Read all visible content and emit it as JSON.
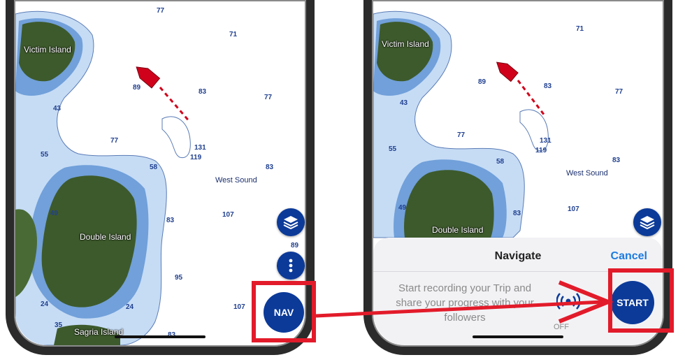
{
  "colors": {
    "water": "#c6dcf5",
    "deep_water": "#ffffff",
    "island": "#3d5a2c",
    "accent_blue": "#0b3a99",
    "highlight_red": "#e21b2a",
    "cancel_blue": "#1c7be0"
  },
  "left_screen": {
    "places": {
      "victim_island": "Victim Island",
      "double_island": "Double Island",
      "west_sound": "West Sound",
      "third_island": "Sagria Island"
    },
    "depths": {
      "d77a": "77",
      "d71": "71",
      "d89": "89",
      "d83a": "83",
      "d77b": "77",
      "d43": "43",
      "d77c": "77",
      "d55": "55",
      "d131": "131",
      "d119": "119",
      "d58": "58",
      "d83b": "83",
      "d49": "49",
      "d83c": "83",
      "d107a": "107",
      "d89b": "89",
      "d95": "95",
      "d24a": "24",
      "d24b": "24",
      "d35": "35",
      "d107b": "107",
      "d83d": "83"
    },
    "nav_label": "NAV",
    "icons": {
      "layers": "layers-icon",
      "more": "more-vertical-icon",
      "boat": "boat-icon"
    }
  },
  "right_screen": {
    "places": {
      "victim_island": "Victim Island",
      "double_island": "Double Island",
      "west_sound": "West Sound"
    },
    "depths": {
      "d71": "71",
      "d89": "89",
      "d83a": "83",
      "d77a": "77",
      "d43": "43",
      "d77b": "77",
      "d55": "55",
      "d131": "131",
      "d119": "119",
      "d58": "58",
      "d83b": "83",
      "d49": "49",
      "d107": "107",
      "d83c": "83"
    },
    "sheet": {
      "title": "Navigate",
      "cancel": "Cancel",
      "message": "Start recording your Trip and share your progress with your followers",
      "toggle_state": "OFF",
      "start_label": "START"
    },
    "icons": {
      "layers": "layers-icon",
      "signal": "broadcast-signal-icon"
    }
  }
}
